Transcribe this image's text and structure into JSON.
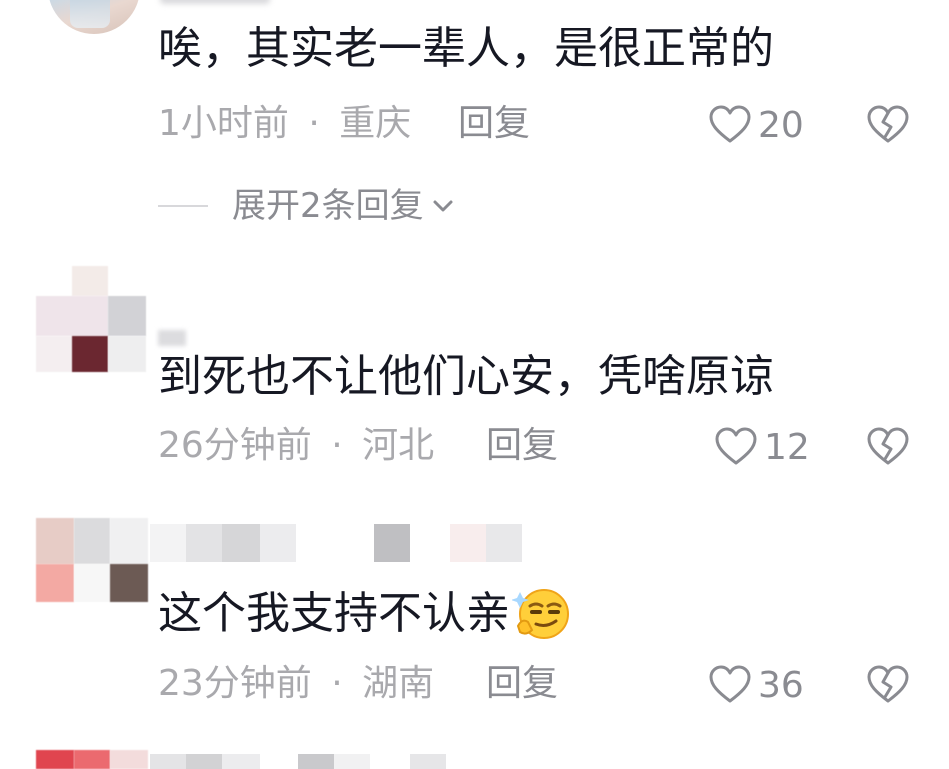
{
  "comments": [
    {
      "text": "唉，其实老一辈人，是很正常的",
      "time": "1小时前",
      "separator": "·",
      "location": "重庆",
      "reply_label": "回复",
      "likes": "20",
      "expand_label": "展开2条回复"
    },
    {
      "text": "到死也不让他们心安，凭啥原谅",
      "time": "26分钟前",
      "separator": "·",
      "location": "河北",
      "reply_label": "回复",
      "likes": "12"
    },
    {
      "text": "这个我支持不认亲",
      "time": "23分钟前",
      "separator": "·",
      "location": "湖南",
      "reply_label": "回复",
      "likes": "36",
      "emoji_icon": "smirk-emoji-icon"
    }
  ],
  "icons": {
    "like": "heart-outline-icon",
    "dislike": "broken-heart-icon",
    "expand": "chevron-down-icon"
  },
  "colors": {
    "text": "#161823",
    "meta": "#a9a9ad",
    "secondary": "#8a8b91",
    "background": "#ffffff"
  }
}
